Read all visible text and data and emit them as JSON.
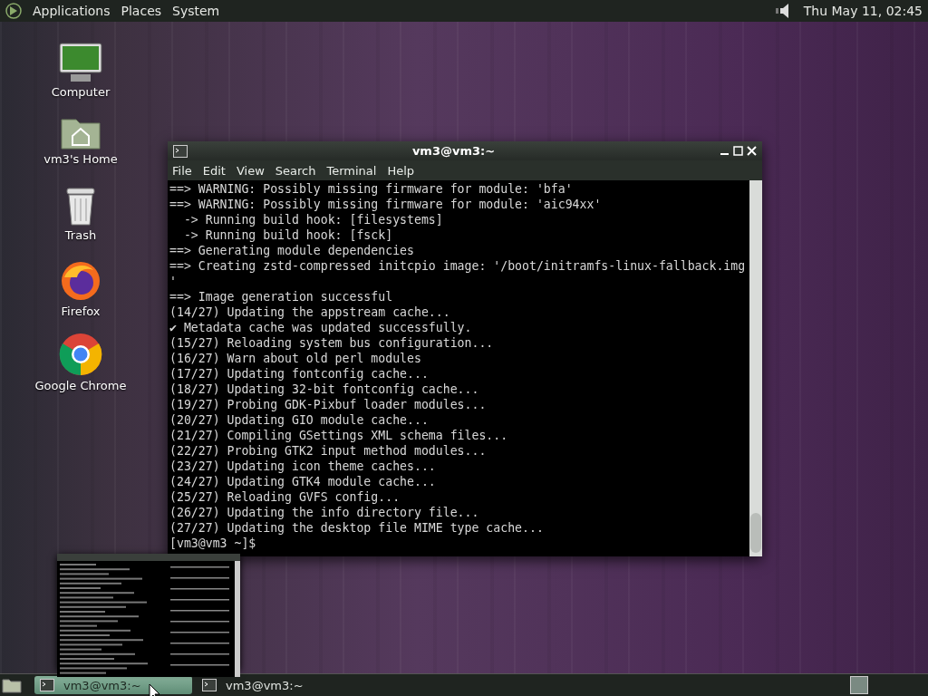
{
  "top_panel": {
    "menus": [
      "Applications",
      "Places",
      "System"
    ],
    "clock": "Thu May 11, 02:45"
  },
  "desktop_icons": [
    {
      "label": "Computer",
      "kind": "computer"
    },
    {
      "label": "vm3's Home",
      "kind": "home"
    },
    {
      "label": "Trash",
      "kind": "trash"
    },
    {
      "label": "Firefox",
      "kind": "firefox"
    },
    {
      "label": "Google Chrome",
      "kind": "chrome"
    }
  ],
  "terminal": {
    "title": "vm3@vm3:~",
    "menu": [
      "File",
      "Edit",
      "View",
      "Search",
      "Terminal",
      "Help"
    ],
    "lines": [
      "==> WARNING: Possibly missing firmware for module: 'bfa'",
      "==> WARNING: Possibly missing firmware for module: 'aic94xx'",
      "  -> Running build hook: [filesystems]",
      "  -> Running build hook: [fsck]",
      "==> Generating module dependencies",
      "==> Creating zstd-compressed initcpio image: '/boot/initramfs-linux-fallback.img",
      "'",
      "==> Image generation successful",
      "(14/27) Updating the appstream cache...",
      "✔ Metadata cache was updated successfully.",
      "(15/27) Reloading system bus configuration...",
      "(16/27) Warn about old perl modules",
      "(17/27) Updating fontconfig cache...",
      "(18/27) Updating 32-bit fontconfig cache...",
      "(19/27) Probing GDK-Pixbuf loader modules...",
      "(20/27) Updating GIO module cache...",
      "(21/27) Compiling GSettings XML schema files...",
      "(22/27) Probing GTK2 input method modules...",
      "(23/27) Updating icon theme caches...",
      "(24/27) Updating GTK4 module cache...",
      "(25/27) Reloading GVFS config...",
      "(26/27) Updating the info directory file...",
      "(27/27) Updating the desktop file MIME type cache...",
      "[vm3@vm3 ~]$"
    ]
  },
  "taskbar": {
    "tasks": [
      {
        "label": "vm3@vm3:~",
        "selected": true
      },
      {
        "label": "vm3@vm3:~",
        "selected": false
      }
    ]
  }
}
